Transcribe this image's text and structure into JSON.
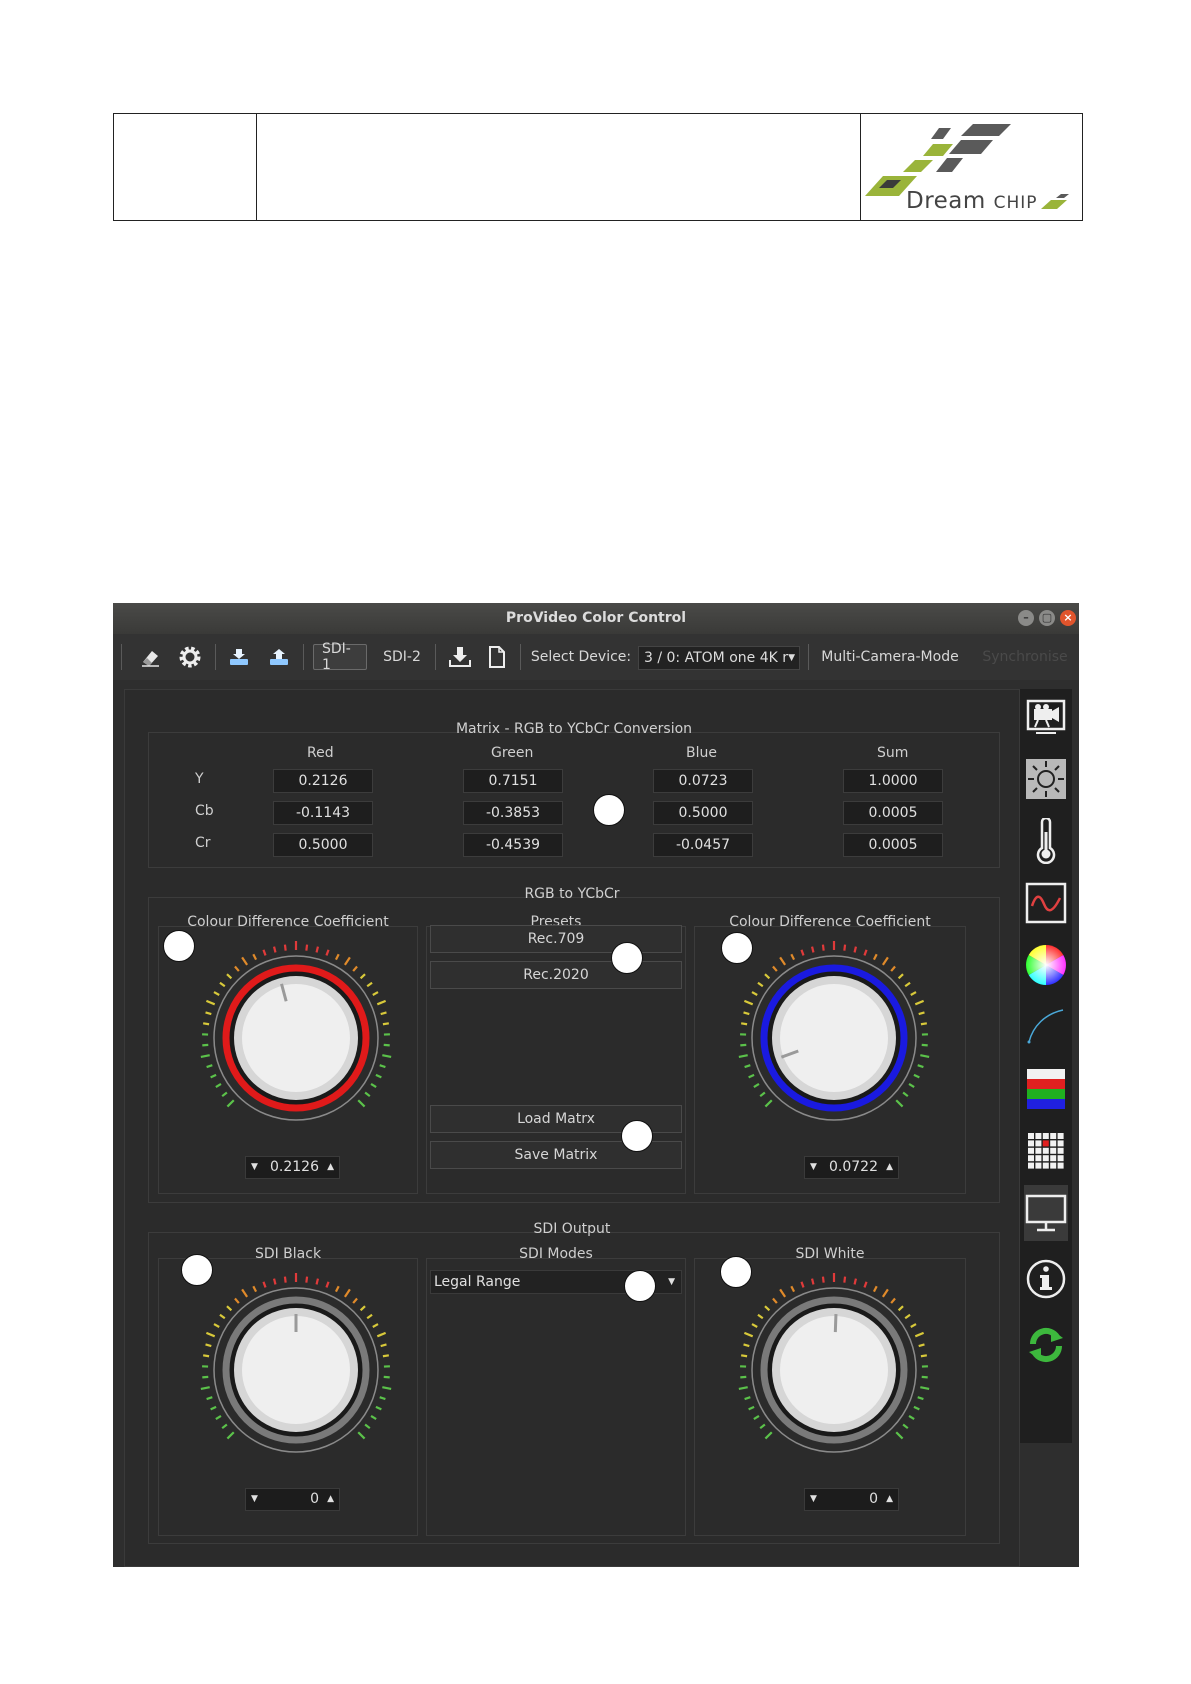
{
  "document_header": {
    "logo_text_part1": "Dream",
    "logo_text_part2": "Chip"
  },
  "window": {
    "title": "ProVideo Color Control"
  },
  "toolbar": {
    "sdi1_label": "SDI-1",
    "sdi2_label": "SDI-2",
    "select_device_label": "Select Device:",
    "device_value": "3 / 0: ATOM one 4K r",
    "multi_camera_label": "Multi-Camera-Mode",
    "synchronise_label": "Synchronise"
  },
  "matrix": {
    "title": "Matrix - RGB to YCbCr Conversion",
    "columns": [
      "Red",
      "Green",
      "Blue",
      "Sum"
    ],
    "rows": [
      {
        "label": "Y",
        "values": [
          "0.2126",
          "0.7151",
          "0.0723",
          "1.0000"
        ]
      },
      {
        "label": "Cb",
        "values": [
          "-0.1143",
          "-0.3853",
          "0.5000",
          "0.0005"
        ]
      },
      {
        "label": "Cr",
        "values": [
          "0.5000",
          "-0.4539",
          "-0.0457",
          "0.0005"
        ]
      }
    ]
  },
  "rgb_to_ycbcr": {
    "title": "RGB to YCbCr",
    "left_title": "Colour Difference Coefficient",
    "left_value": "0.2126",
    "left_ring_color": "#e01a1a",
    "presets_title": "Presets",
    "preset_rec709": "Rec.709",
    "preset_rec2020": "Rec.2020",
    "load_matrix": "Load Matrx",
    "save_matrix": "Save Matrix",
    "right_title": "Colour Difference Coefficient",
    "right_value": "0.0722",
    "right_ring_color": "#1a1ae0"
  },
  "sdi_output": {
    "title": "SDI Output",
    "black_title": "SDI Black",
    "black_value": "0",
    "modes_title": "SDI Modes",
    "modes_value": "Legal Range",
    "white_title": "SDI White",
    "white_value": "0"
  },
  "sidebar_icons": [
    "camera-icon",
    "brightness-icon",
    "thermometer-icon",
    "waveform-icon",
    "color-wheel-icon",
    "curve-icon",
    "rgb-bars-icon",
    "grid-icon",
    "monitor-icon",
    "info-icon",
    "refresh-icon"
  ]
}
